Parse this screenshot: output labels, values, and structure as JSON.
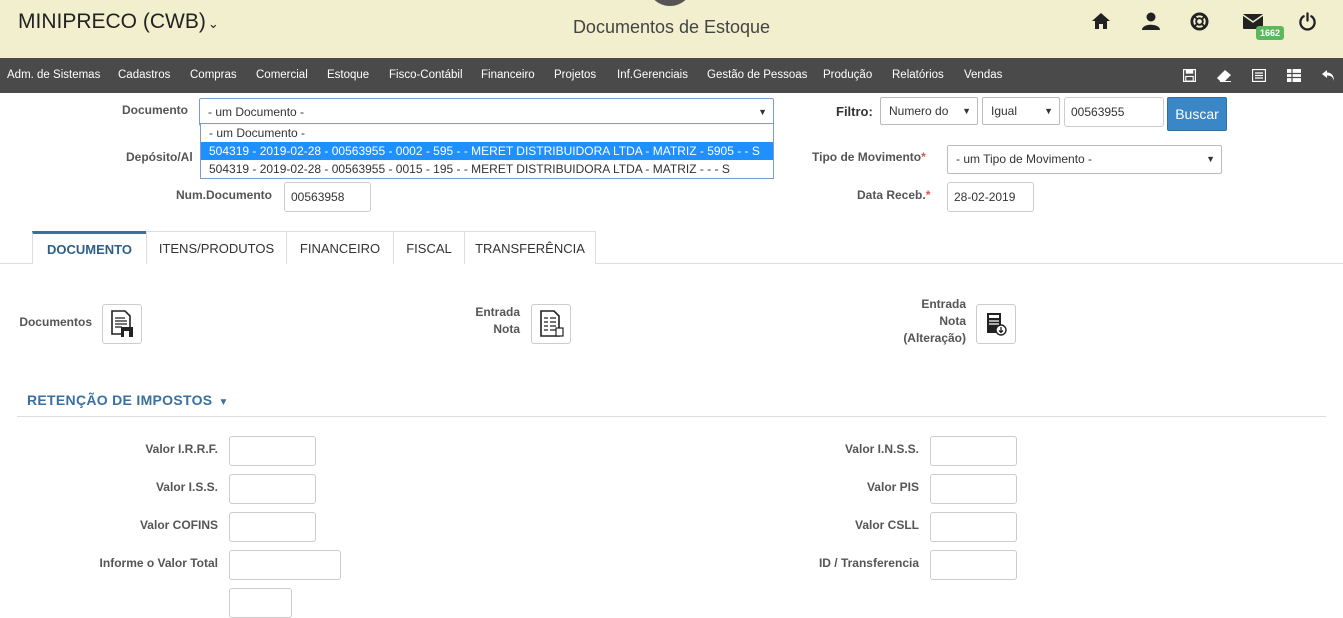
{
  "header": {
    "brand": "MINIPRECO (CWB)",
    "brand_caret": "⌄",
    "title": "Documentos de Estoque",
    "badge": "1662",
    "icons": [
      "home-icon",
      "user-icon",
      "lifebuoy-icon",
      "mail-icon",
      "power-icon"
    ]
  },
  "nav": {
    "items": [
      "Adm. de Sistemas",
      "Cadastros",
      "Compras",
      "Comercial",
      "Estoque",
      "Fisco-Contábil",
      "Financeiro",
      "Projetos",
      "Inf.Gerenciais",
      "Gestão de Pessoas",
      "Produção",
      "Relatórios",
      "Vendas"
    ],
    "icons": [
      "save-icon",
      "eraser-icon",
      "list-icon",
      "grid-icon",
      "back-icon"
    ]
  },
  "form": {
    "documento_label": "Documento",
    "documento_value": "- um Documento -",
    "deposito_label": "Depósito/Al",
    "num_documento_label": "Num.Documento",
    "num_documento_value": "00563958",
    "filtro_label": "Filtro:",
    "filtro_campo": "Numero do",
    "filtro_operador": "Igual",
    "filtro_valor": "00563955",
    "buscar_label": "Buscar",
    "tipo_movimento_label": "Tipo de Movimento",
    "tipo_movimento_value": "- um Tipo de Movimento -",
    "data_receb_label": "Data Receb.",
    "data_receb_value": "28-02-2019",
    "required_mark": "*"
  },
  "dropdown": {
    "options": [
      "- um Documento -",
      "504319 - 2019-02-28 - 00563955 - 0002 - 595 - - MERET DISTRIBUIDORA LTDA - MATRIZ - 5905 - - S",
      "504319 - 2019-02-28 - 00563955 - 0015 - 195 - - MERET DISTRIBUIDORA LTDA - MATRIZ - - - S"
    ]
  },
  "tabs": [
    "DOCUMENTO",
    "ITENS/PRODUTOS",
    "FINANCEIRO",
    "FISCAL",
    "TRANSFERÊNCIA"
  ],
  "documents": {
    "documentos_label": "Documentos",
    "entrada_nota_line1": "Entrada",
    "entrada_nota_line2": "Nota",
    "entrada_alt_line1": "Entrada",
    "entrada_alt_line2": "Nota",
    "entrada_alt_line3": "(Alteração)"
  },
  "retencao": {
    "title": "RETENÇÃO DE IMPOSTOS",
    "caret": "▼",
    "irrf_label": "Valor I.R.R.F.",
    "iss_label": "Valor I.S.S.",
    "cofins_label": "Valor COFINS",
    "total_label": "Informe o Valor Total",
    "inss_label": "Valor I.N.S.S.",
    "pis_label": "Valor PIS",
    "csll_label": "Valor CSLL",
    "transferencia_label": "ID / Transferencia"
  }
}
